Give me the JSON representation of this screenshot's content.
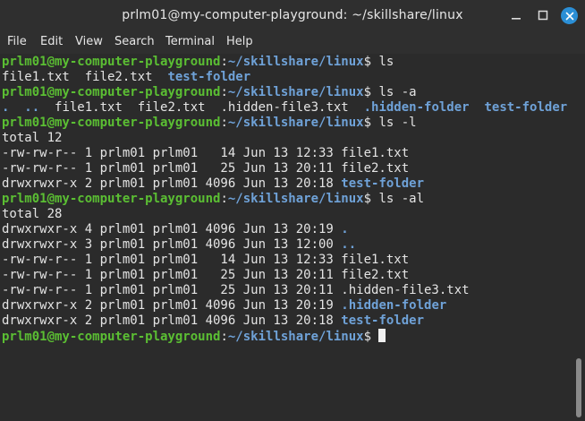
{
  "window": {
    "title": "prlm01@my-computer-playground: ~/skillshare/linux"
  },
  "menu": {
    "file": "File",
    "edit": "Edit",
    "view": "View",
    "search": "Search",
    "terminal": "Terminal",
    "help": "Help"
  },
  "prompt": {
    "host": "prlm01@my-computer-playground",
    "colon": ":",
    "path": "~/skillshare/linux",
    "symbol": "$ "
  },
  "colors": {
    "prompt_user_host": "#5bbf33",
    "prompt_path": "#6fa2d8",
    "directory": "#6fa2d8",
    "text": "#e4e4e4",
    "background": "#2b2b2b",
    "close_button": "#2b8fd6"
  },
  "lines": [
    [
      {
        "t": "prompt"
      },
      {
        "t": "text",
        "v": "ls"
      }
    ],
    [
      {
        "t": "text",
        "v": "file1.txt  file2.txt  "
      },
      {
        "t": "dir",
        "v": "test-folder"
      }
    ],
    [
      {
        "t": "prompt"
      },
      {
        "t": "text",
        "v": "ls -a"
      }
    ],
    [
      {
        "t": "dir",
        "v": "."
      },
      {
        "t": "text",
        "v": "  "
      },
      {
        "t": "dir",
        "v": ".."
      },
      {
        "t": "text",
        "v": "  file1.txt  file2.txt  .hidden-file3.txt  "
      },
      {
        "t": "dir",
        "v": ".hidden-folder"
      },
      {
        "t": "text",
        "v": "  "
      },
      {
        "t": "dir",
        "v": "test-folder"
      }
    ],
    [
      {
        "t": "prompt"
      },
      {
        "t": "text",
        "v": "ls -l"
      }
    ],
    [
      {
        "t": "text",
        "v": "total 12"
      }
    ],
    [
      {
        "t": "text",
        "v": "-rw-rw-r-- 1 prlm01 prlm01   14 Jun 13 12:33 file1.txt"
      }
    ],
    [
      {
        "t": "text",
        "v": "-rw-rw-r-- 1 prlm01 prlm01   25 Jun 13 20:11 file2.txt"
      }
    ],
    [
      {
        "t": "text",
        "v": "drwxrwxr-x 2 prlm01 prlm01 4096 Jun 13 20:18 "
      },
      {
        "t": "dir",
        "v": "test-folder"
      }
    ],
    [
      {
        "t": "prompt"
      },
      {
        "t": "text",
        "v": "ls -al"
      }
    ],
    [
      {
        "t": "text",
        "v": "total 28"
      }
    ],
    [
      {
        "t": "text",
        "v": "drwxrwxr-x 4 prlm01 prlm01 4096 Jun 13 20:19 "
      },
      {
        "t": "dir",
        "v": "."
      }
    ],
    [
      {
        "t": "text",
        "v": "drwxrwxr-x 3 prlm01 prlm01 4096 Jun 13 12:00 "
      },
      {
        "t": "dir",
        "v": ".."
      }
    ],
    [
      {
        "t": "text",
        "v": "-rw-rw-r-- 1 prlm01 prlm01   14 Jun 13 12:33 file1.txt"
      }
    ],
    [
      {
        "t": "text",
        "v": "-rw-rw-r-- 1 prlm01 prlm01   25 Jun 13 20:11 file2.txt"
      }
    ],
    [
      {
        "t": "text",
        "v": "-rw-rw-r-- 1 prlm01 prlm01   25 Jun 13 20:11 .hidden-file3.txt"
      }
    ],
    [
      {
        "t": "text",
        "v": "drwxrwxr-x 2 prlm01 prlm01 4096 Jun 13 20:19 "
      },
      {
        "t": "dir",
        "v": ".hidden-folder"
      }
    ],
    [
      {
        "t": "text",
        "v": "drwxrwxr-x 2 prlm01 prlm01 4096 Jun 13 20:18 "
      },
      {
        "t": "dir",
        "v": "test-folder"
      }
    ],
    [
      {
        "t": "prompt"
      },
      {
        "t": "cursor"
      }
    ]
  ]
}
